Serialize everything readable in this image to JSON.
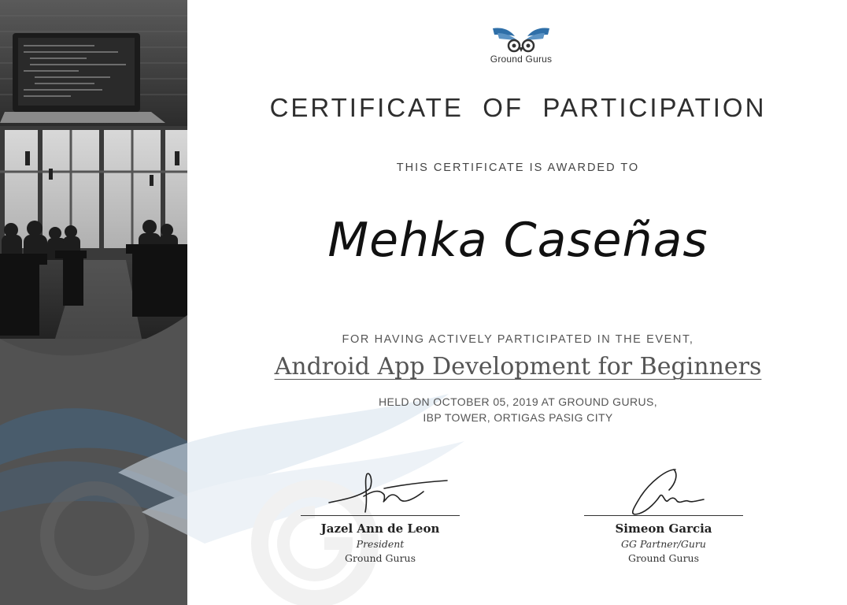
{
  "certificate": {
    "logo_name": "Ground Gurus",
    "title": "CERTIFICATE  OF  PARTICIPATION",
    "awarded_line": "THIS CERTIFICATE IS AWARDED TO",
    "recipient": "Mehka Caseñas",
    "participation_line": "FOR HAVING ACTIVELY PARTICIPATED IN THE EVENT,",
    "event_name": "Android App Development for Beginners",
    "held_line_1": "HELD ON OCTOBER 05, 2019 AT GROUND GURUS,",
    "held_line_2": "IBP TOWER, ORTIGAS PASIG CITY"
  },
  "signatories": [
    {
      "name": "Jazel Ann de Leon",
      "role": "President",
      "organization": "Ground Gurus"
    },
    {
      "name": "Simeon Garcia",
      "role": "GG Partner/Guru",
      "organization": "Ground Gurus"
    }
  ],
  "colors": {
    "brand_blue": "#2f6fa8",
    "text_dark": "#2e2e2e",
    "strip_gray": "#4a4a4a"
  }
}
